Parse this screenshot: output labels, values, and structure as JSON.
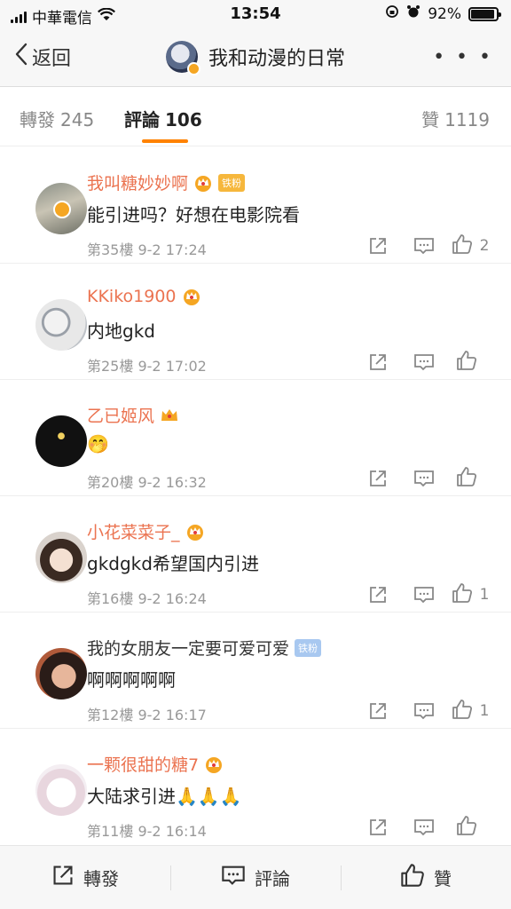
{
  "status_bar": {
    "carrier": "中華電信",
    "time": "13:54",
    "battery": "92%",
    "battery_level": 0.92
  },
  "nav": {
    "back_label": "返回",
    "title": "我和动漫的日常",
    "more_label": "• • •"
  },
  "tabs": {
    "repost": {
      "label": "轉發",
      "count": "245"
    },
    "comment": {
      "label": "評論",
      "count": "106"
    },
    "like": {
      "label": "贊",
      "count": "1119"
    }
  },
  "comments": [
    {
      "user": "我叫糖妙妙啊",
      "badge": "铁粉",
      "text": "能引进吗？好想在电影院看",
      "floor": "第35樓",
      "time": "9-2 17:24",
      "likes": "2"
    },
    {
      "user": "KKiko1900",
      "badge": "",
      "text": "内地gkd",
      "floor": "第25樓",
      "time": "9-2 17:02",
      "likes": ""
    },
    {
      "user": "乙已姬风",
      "badge": "",
      "text": "🤭",
      "floor": "第20樓",
      "time": "9-2 16:32",
      "likes": ""
    },
    {
      "user": "小花菜菜子_",
      "badge": "",
      "text": "gkdgkd希望国内引进",
      "floor": "第16樓",
      "time": "9-2 16:24",
      "likes": "1"
    },
    {
      "user": "我的女朋友一定要可爱可爱",
      "badge": "铁粉",
      "text": "啊啊啊啊啊",
      "floor": "第12樓",
      "time": "9-2 16:17",
      "likes": "1"
    },
    {
      "user": "一颗很甜的糖7",
      "badge": "",
      "text": "大陆求引进🙏🙏🙏",
      "floor": "第11樓",
      "time": "9-2 16:14",
      "likes": ""
    }
  ],
  "bottom_bar": {
    "repost_label": "轉發",
    "comment_label": "評論",
    "like_label": "贊"
  },
  "colors": {
    "accent": "#ff8200",
    "username": "#eb7350",
    "crown": "#f5a623"
  }
}
